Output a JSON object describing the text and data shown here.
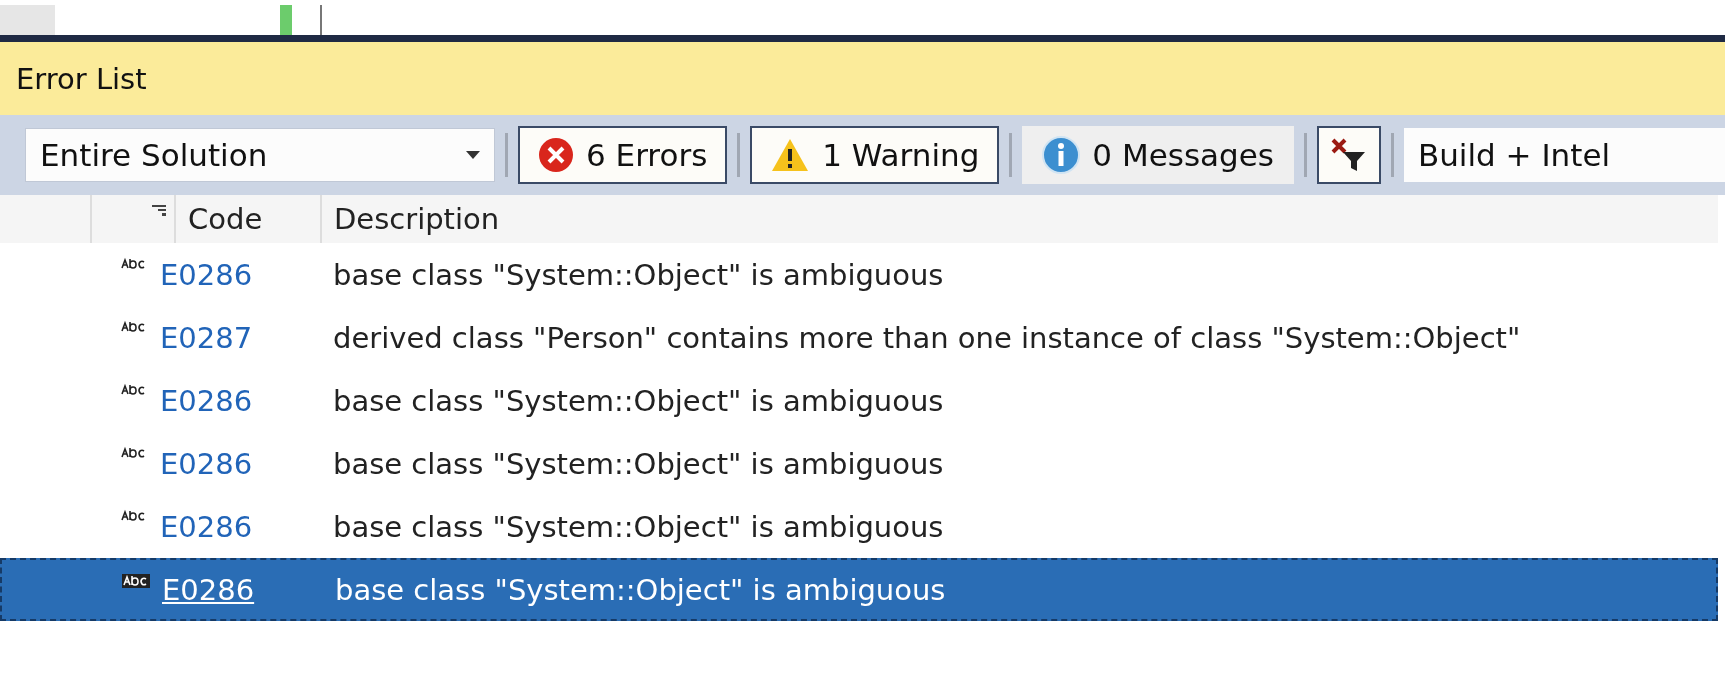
{
  "panel": {
    "title": "Error List"
  },
  "toolbar": {
    "scope": "Entire Solution",
    "filters": [
      {
        "kind": "error",
        "label": "6 Errors",
        "selected": true
      },
      {
        "kind": "warning",
        "label": "1 Warning",
        "selected": true
      },
      {
        "kind": "info",
        "label": "0 Messages",
        "selected": false
      }
    ],
    "source": "Build + Intel"
  },
  "table": {
    "columns": [
      "Code",
      "Description"
    ],
    "rows": [
      {
        "code": "E0286",
        "description": "base class \"System::Object\" is ambiguous",
        "selected": false
      },
      {
        "code": "E0287",
        "description": "derived class \"Person\" contains more than one instance of class \"System::Object\"",
        "selected": false
      },
      {
        "code": "E0286",
        "description": "base class \"System::Object\" is ambiguous",
        "selected": false
      },
      {
        "code": "E0286",
        "description": "base class \"System::Object\" is ambiguous",
        "selected": false
      },
      {
        "code": "E0286",
        "description": "base class \"System::Object\" is ambiguous",
        "selected": false
      },
      {
        "code": "E0286",
        "description": "base class \"System::Object\" is ambiguous",
        "selected": true
      }
    ]
  }
}
